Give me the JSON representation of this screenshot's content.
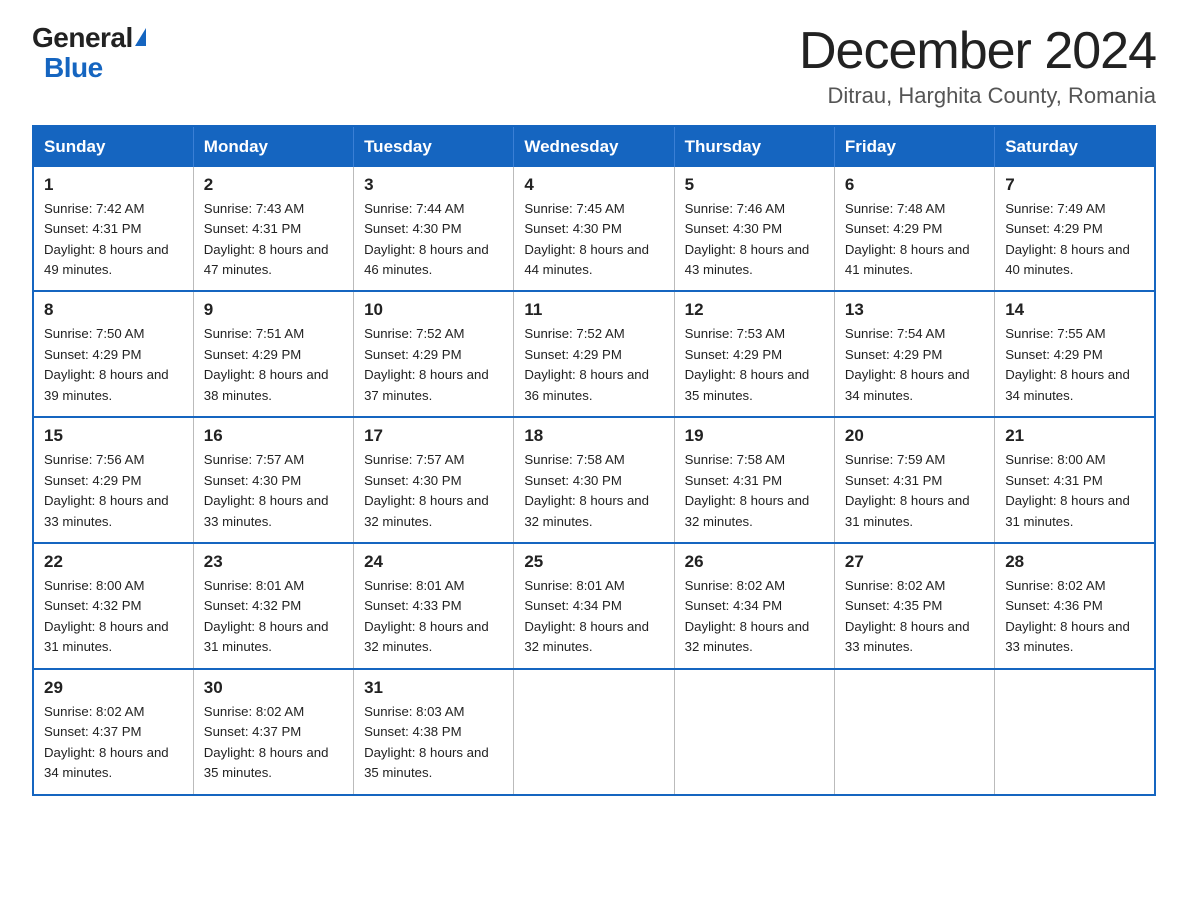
{
  "logo": {
    "general": "General",
    "blue": "Blue",
    "triangle": "▶"
  },
  "title": "December 2024",
  "subtitle": "Ditrau, Harghita County, Romania",
  "weekdays": [
    "Sunday",
    "Monday",
    "Tuesday",
    "Wednesday",
    "Thursday",
    "Friday",
    "Saturday"
  ],
  "weeks": [
    [
      {
        "day": "1",
        "sunrise": "7:42 AM",
        "sunset": "4:31 PM",
        "daylight": "8 hours and 49 minutes."
      },
      {
        "day": "2",
        "sunrise": "7:43 AM",
        "sunset": "4:31 PM",
        "daylight": "8 hours and 47 minutes."
      },
      {
        "day": "3",
        "sunrise": "7:44 AM",
        "sunset": "4:30 PM",
        "daylight": "8 hours and 46 minutes."
      },
      {
        "day": "4",
        "sunrise": "7:45 AM",
        "sunset": "4:30 PM",
        "daylight": "8 hours and 44 minutes."
      },
      {
        "day": "5",
        "sunrise": "7:46 AM",
        "sunset": "4:30 PM",
        "daylight": "8 hours and 43 minutes."
      },
      {
        "day": "6",
        "sunrise": "7:48 AM",
        "sunset": "4:29 PM",
        "daylight": "8 hours and 41 minutes."
      },
      {
        "day": "7",
        "sunrise": "7:49 AM",
        "sunset": "4:29 PM",
        "daylight": "8 hours and 40 minutes."
      }
    ],
    [
      {
        "day": "8",
        "sunrise": "7:50 AM",
        "sunset": "4:29 PM",
        "daylight": "8 hours and 39 minutes."
      },
      {
        "day": "9",
        "sunrise": "7:51 AM",
        "sunset": "4:29 PM",
        "daylight": "8 hours and 38 minutes."
      },
      {
        "day": "10",
        "sunrise": "7:52 AM",
        "sunset": "4:29 PM",
        "daylight": "8 hours and 37 minutes."
      },
      {
        "day": "11",
        "sunrise": "7:52 AM",
        "sunset": "4:29 PM",
        "daylight": "8 hours and 36 minutes."
      },
      {
        "day": "12",
        "sunrise": "7:53 AM",
        "sunset": "4:29 PM",
        "daylight": "8 hours and 35 minutes."
      },
      {
        "day": "13",
        "sunrise": "7:54 AM",
        "sunset": "4:29 PM",
        "daylight": "8 hours and 34 minutes."
      },
      {
        "day": "14",
        "sunrise": "7:55 AM",
        "sunset": "4:29 PM",
        "daylight": "8 hours and 34 minutes."
      }
    ],
    [
      {
        "day": "15",
        "sunrise": "7:56 AM",
        "sunset": "4:29 PM",
        "daylight": "8 hours and 33 minutes."
      },
      {
        "day": "16",
        "sunrise": "7:57 AM",
        "sunset": "4:30 PM",
        "daylight": "8 hours and 33 minutes."
      },
      {
        "day": "17",
        "sunrise": "7:57 AM",
        "sunset": "4:30 PM",
        "daylight": "8 hours and 32 minutes."
      },
      {
        "day": "18",
        "sunrise": "7:58 AM",
        "sunset": "4:30 PM",
        "daylight": "8 hours and 32 minutes."
      },
      {
        "day": "19",
        "sunrise": "7:58 AM",
        "sunset": "4:31 PM",
        "daylight": "8 hours and 32 minutes."
      },
      {
        "day": "20",
        "sunrise": "7:59 AM",
        "sunset": "4:31 PM",
        "daylight": "8 hours and 31 minutes."
      },
      {
        "day": "21",
        "sunrise": "8:00 AM",
        "sunset": "4:31 PM",
        "daylight": "8 hours and 31 minutes."
      }
    ],
    [
      {
        "day": "22",
        "sunrise": "8:00 AM",
        "sunset": "4:32 PM",
        "daylight": "8 hours and 31 minutes."
      },
      {
        "day": "23",
        "sunrise": "8:01 AM",
        "sunset": "4:32 PM",
        "daylight": "8 hours and 31 minutes."
      },
      {
        "day": "24",
        "sunrise": "8:01 AM",
        "sunset": "4:33 PM",
        "daylight": "8 hours and 32 minutes."
      },
      {
        "day": "25",
        "sunrise": "8:01 AM",
        "sunset": "4:34 PM",
        "daylight": "8 hours and 32 minutes."
      },
      {
        "day": "26",
        "sunrise": "8:02 AM",
        "sunset": "4:34 PM",
        "daylight": "8 hours and 32 minutes."
      },
      {
        "day": "27",
        "sunrise": "8:02 AM",
        "sunset": "4:35 PM",
        "daylight": "8 hours and 33 minutes."
      },
      {
        "day": "28",
        "sunrise": "8:02 AM",
        "sunset": "4:36 PM",
        "daylight": "8 hours and 33 minutes."
      }
    ],
    [
      {
        "day": "29",
        "sunrise": "8:02 AM",
        "sunset": "4:37 PM",
        "daylight": "8 hours and 34 minutes."
      },
      {
        "day": "30",
        "sunrise": "8:02 AM",
        "sunset": "4:37 PM",
        "daylight": "8 hours and 35 minutes."
      },
      {
        "day": "31",
        "sunrise": "8:03 AM",
        "sunset": "4:38 PM",
        "daylight": "8 hours and 35 minutes."
      },
      null,
      null,
      null,
      null
    ]
  ]
}
